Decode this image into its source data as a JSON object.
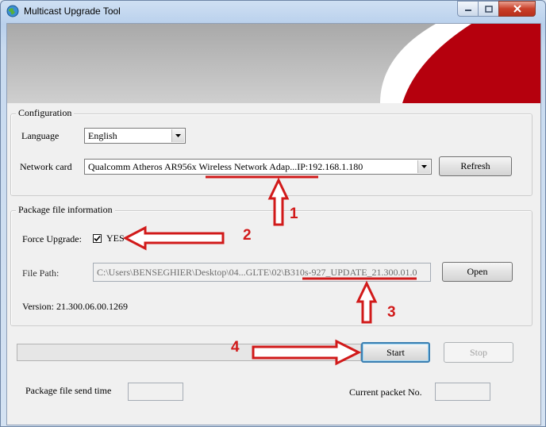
{
  "window": {
    "title": "Multicast Upgrade Tool",
    "controls": [
      "minimize",
      "maximize",
      "close"
    ]
  },
  "colors": {
    "banner_red": "#b5000d",
    "annotation_red": "#d11a1a",
    "title_gray": "#9a9a9a"
  },
  "configuration": {
    "group_title": "Configuration",
    "language_label": "Language",
    "language_value": "English",
    "network_label": "Network card",
    "network_value": "Qualcomm Atheros AR956x Wireless Network Adap...IP:192.168.1.180",
    "refresh_label": "Refresh"
  },
  "package": {
    "group_title": "Package file information",
    "force_label": "Force Upgrade:",
    "force_checked": true,
    "force_value": "YES",
    "file_path_label": "File Path:",
    "file_path_value": "C:\\Users\\BENSEGHIER\\Desktop\\04...GLTE\\02\\B310s-927_UPDATE_21.300.01.0",
    "open_label": "Open",
    "version_text": "Version: 21.300.06.00.1269"
  },
  "actions": {
    "start_label": "Start",
    "stop_label": "Stop"
  },
  "status": {
    "send_time_label": "Package file send time",
    "send_time_value": "",
    "packet_label": "Current packet No.",
    "packet_value": ""
  },
  "annotations": [
    "1",
    "2",
    "3",
    "4"
  ]
}
